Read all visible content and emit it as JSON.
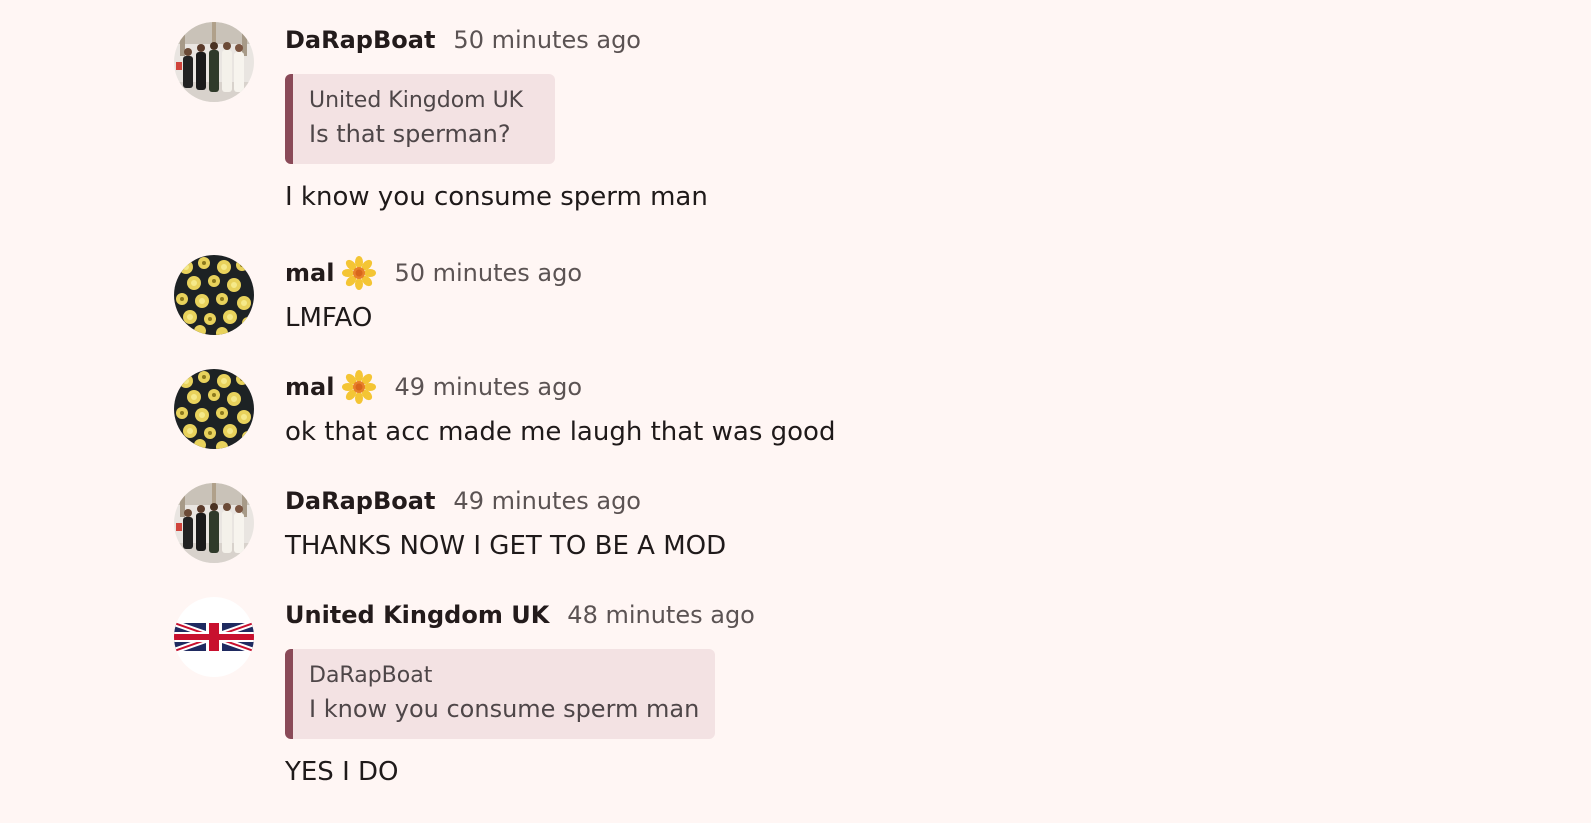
{
  "messages": [
    {
      "author": "DaRapBoat",
      "time": "50 minutes ago",
      "avatar": "group-photo-avatar",
      "quote": {
        "author": "United Kingdom UK",
        "text": "Is that sperman?"
      },
      "text": "I know you consume sperm man"
    },
    {
      "author": "mal",
      "badge": "sunflower-icon",
      "time": "50 minutes ago",
      "avatar": "flowers-avatar",
      "text": "LMFAO"
    },
    {
      "author": "mal",
      "badge": "sunflower-icon",
      "time": "49 minutes ago",
      "avatar": "flowers-avatar",
      "text": "ok that acc made me laugh that was good"
    },
    {
      "author": "DaRapBoat",
      "time": "49 minutes ago",
      "avatar": "group-photo-avatar",
      "text": "THANKS NOW I GET TO BE A MOD"
    },
    {
      "author": "United Kingdom UK",
      "time": "48 minutes ago",
      "avatar": "union-jack-avatar",
      "quote": {
        "author": "DaRapBoat",
        "text": "I know you consume sperm man"
      },
      "text": "YES I DO"
    }
  ],
  "colors": {
    "background": "#fff6f4",
    "quote_background": "#f3e2e3",
    "quote_border": "#8a4a58"
  }
}
